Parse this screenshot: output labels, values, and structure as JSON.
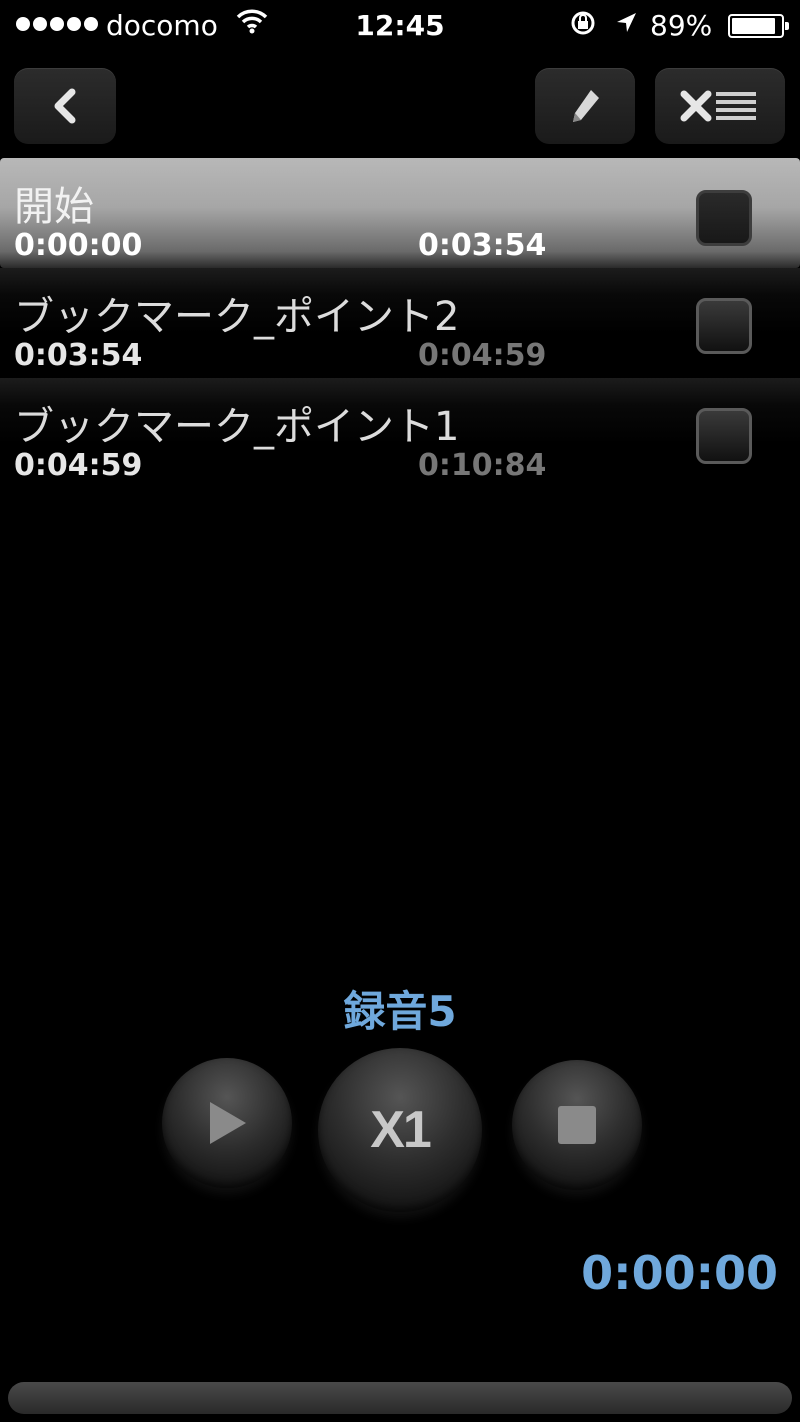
{
  "status_bar": {
    "carrier": "docomo",
    "time": "12:45",
    "battery_percent": "89%",
    "battery_level": 0.89,
    "icons": [
      "signal-dots-icon",
      "wifi-icon",
      "rotation-lock-icon",
      "location-arrow-icon",
      "battery-icon"
    ]
  },
  "toolbar": {
    "back_icon": "chevron-left-icon",
    "edit_icon": "pencil-icon",
    "delete_icon": "delete-list-icon"
  },
  "bookmarks": [
    {
      "title": "開始",
      "start": "0:00:00",
      "end": "0:03:54",
      "selected": true,
      "checked": false
    },
    {
      "title": "ブックマーク_ポイント2",
      "start": "0:03:54",
      "end": "0:04:59",
      "selected": false,
      "checked": false
    },
    {
      "title": "ブックマーク_ポイント1",
      "start": "0:04:59",
      "end": "0:10:84",
      "selected": false,
      "checked": false
    }
  ],
  "player": {
    "recording_name": "録音5",
    "speed_label": "X1",
    "elapsed": "0:00:00",
    "progress": 0,
    "accent_color": "#6fa8dc"
  }
}
